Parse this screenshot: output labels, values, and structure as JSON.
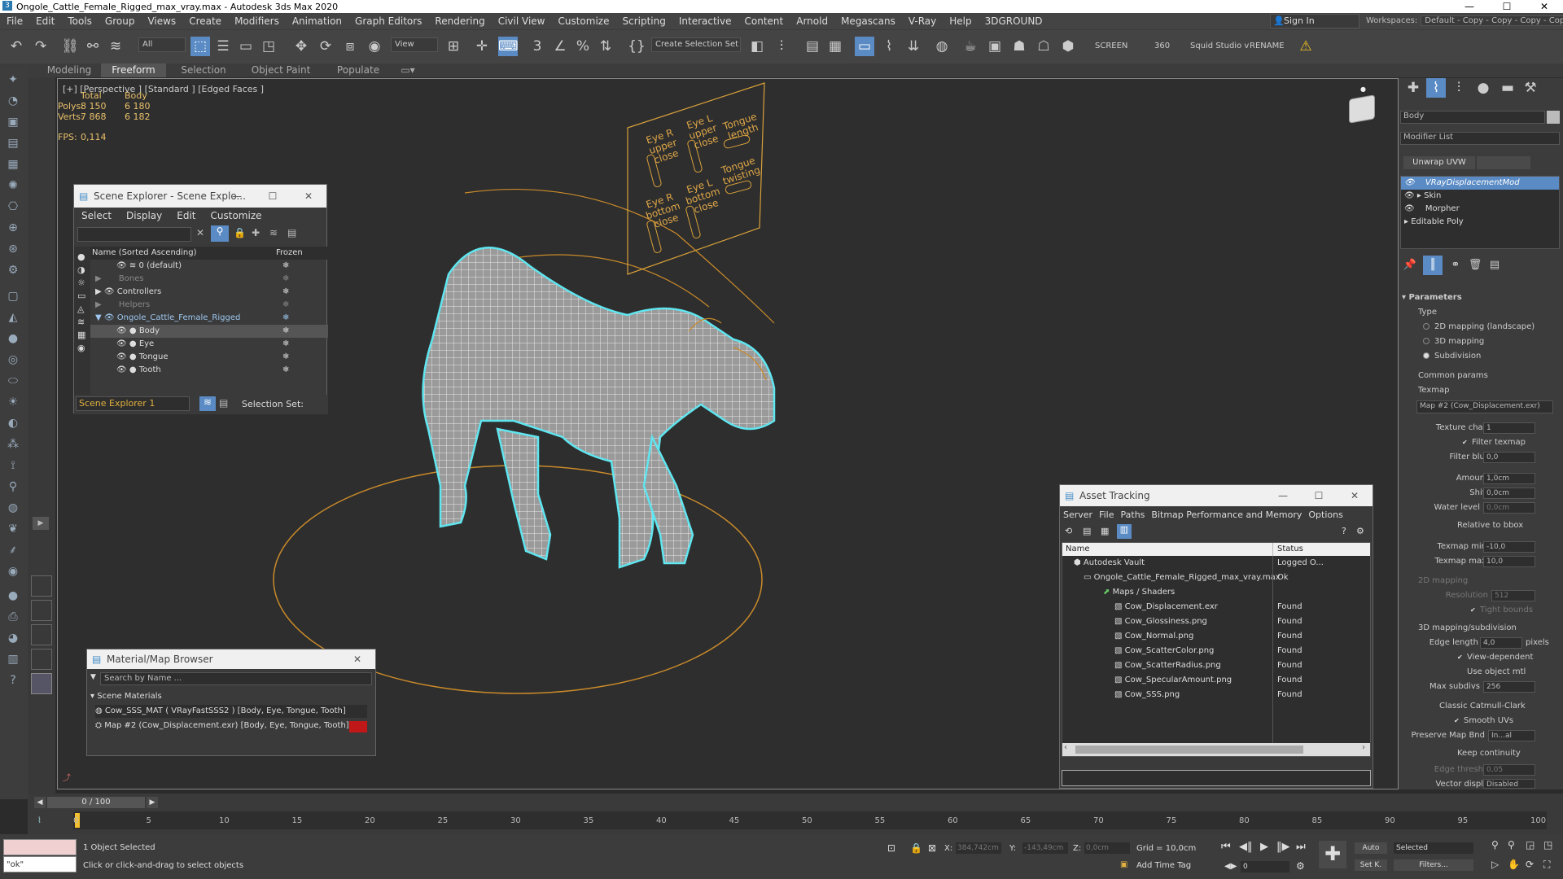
{
  "window": {
    "title": "Ongole_Cattle_Female_Rigged_max_vray.max - Autodesk 3ds Max 2020",
    "min": "—",
    "max": "☐",
    "close": "✕"
  },
  "menu": [
    "File",
    "Edit",
    "Tools",
    "Group",
    "Views",
    "Create",
    "Modifiers",
    "Animation",
    "Graph Editors",
    "Rendering",
    "Civil View",
    "Customize",
    "Scripting",
    "Interactive",
    "Content",
    "Arnold",
    "Megascans",
    "V-Ray",
    "Help",
    "3DGROUND"
  ],
  "signin": "Sign In",
  "workspaces": {
    "label": "Workspaces:",
    "value": "Default - Copy - Copy - Copy - Copy"
  },
  "toolbar": {
    "filter": "All",
    "view": "View",
    "selset": "Create Selection Set",
    "screen": "SCREEN",
    "n360": "360",
    "squid": "Squid Studio v",
    "rename": "RENAME"
  },
  "ribbon": [
    "Modeling",
    "Freeform",
    "Selection",
    "Object Paint",
    "Populate"
  ],
  "viewport": {
    "label": "[+] [Perspective ] [Standard ] [Edged Faces ]",
    "total": "Total",
    "body": "Body",
    "polys_label": "Polys:",
    "polys_total": "8 150",
    "polys_body": "6 180",
    "verts_label": "Verts:",
    "verts_total": "7 868",
    "verts_body": "6 182",
    "fps_label": "FPS:",
    "fps": "0,114"
  },
  "panel": {
    "labels": [
      "Eye R upper close",
      "Eye L upper close",
      "Tongue length",
      "Eye R bottom close",
      "Eye L bottom close",
      "Tongue twisting"
    ]
  },
  "scene_explorer": {
    "title": "Scene Explorer - Scene Explo...",
    "menu": [
      "Select",
      "Display",
      "Edit",
      "Customize"
    ],
    "col_name": "Name (Sorted Ascending)",
    "col_frozen": "Frozen",
    "rows": [
      "0 (default)",
      "Bones",
      "Controllers",
      "Helpers",
      "Ongole_Cattle_Female_Rigged",
      "Body",
      "Eye",
      "Tongue",
      "Tooth"
    ],
    "footer_name": "Scene Explorer 1",
    "footer_selset": "Selection Set:"
  },
  "material_browser": {
    "title": "Material/Map Browser",
    "search": "Search by Name ...",
    "section": "Scene Materials",
    "items": [
      "Cow_SSS_MAT  ( VRayFastSSS2 )  [Body, Eye, Tongue, Tooth]",
      "Map #2 (Cow_Displacement.exr)  [Body, Eye, Tongue, Tooth]"
    ]
  },
  "asset_tracking": {
    "title": "Asset Tracking",
    "menu": [
      "Server",
      "File",
      "Paths",
      "Bitmap Performance and Memory",
      "Options"
    ],
    "col_name": "Name",
    "col_status": "Status",
    "rows": [
      {
        "name": "Autodesk Vault",
        "status": "Logged O..."
      },
      {
        "name": "Ongole_Cattle_Female_Rigged_max_vray.max",
        "status": "Ok"
      },
      {
        "name": "Maps / Shaders",
        "status": ""
      },
      {
        "name": "Cow_Displacement.exr",
        "status": "Found"
      },
      {
        "name": "Cow_Glossiness.png",
        "status": "Found"
      },
      {
        "name": "Cow_Normal.png",
        "status": "Found"
      },
      {
        "name": "Cow_ScatterColor.png",
        "status": "Found"
      },
      {
        "name": "Cow_ScatterRadius.png",
        "status": "Found"
      },
      {
        "name": "Cow_SpecularAmount.png",
        "status": "Found"
      },
      {
        "name": "Cow_SSS.png",
        "status": "Found"
      }
    ]
  },
  "command_panel": {
    "object_name": "Body",
    "modifier_list": "Modifier List",
    "unwrap": "Unwrap UVW",
    "stack": [
      "VRayDisplacementMod",
      "Skin",
      "Morpher",
      "Editable Poly"
    ],
    "parameters": "Parameters",
    "type": "Type",
    "type_opts": [
      "2D mapping (landscape)",
      "3D mapping",
      "Subdivision"
    ],
    "common": "Common params",
    "texmap": "Texmap",
    "texmap_value": "Map #2 (Cow_Displacement.exr)",
    "texture_chan": "Texture chan",
    "texture_chan_v": "1",
    "filter_texmap": "Filter texmap",
    "filter_blur": "Filter blur",
    "filter_blur_v": "0,0",
    "amount": "Amount",
    "amount_v": "1,0cm",
    "shift": "Shift",
    "shift_v": "0,0cm",
    "water": "Water level",
    "water_v": "0,0cm",
    "rel_bbox": "Relative to bbox",
    "tex_min": "Texmap min",
    "tex_min_v": "-10,0",
    "tex_max": "Texmap max",
    "tex_max_v": "10,0",
    "map2d": "2D mapping",
    "resolution": "Resolution",
    "resolution_v": "512",
    "tight": "Tight bounds",
    "map3d": "3D mapping/subdivision",
    "edge_len": "Edge length",
    "edge_len_v": "4,0",
    "pixels": "pixels",
    "view_dep": "View-dependent",
    "use_obj": "Use object mtl",
    "max_subdivs": "Max subdivs",
    "max_subdivs_v": "256",
    "catmull": "Classic Catmull-Clark",
    "smooth_uv": "Smooth UVs",
    "preserve": "Preserve Map Bnd",
    "preserve_v": "In...al",
    "keep": "Keep continuity",
    "edge_thresh": "Edge thresh",
    "edge_thresh_v": "0,05",
    "vector": "Vector displ",
    "vector_v": "Disabled"
  },
  "timeline": {
    "frame": "0 / 100",
    "ticks": [
      "0",
      "5",
      "10",
      "15",
      "20",
      "25",
      "30",
      "35",
      "40",
      "45",
      "50",
      "55",
      "60",
      "65",
      "70",
      "75",
      "80",
      "85",
      "90",
      "95",
      "100"
    ]
  },
  "status": {
    "maxscript": "\"ok\"",
    "selected": "1 Object Selected",
    "prompt": "Click or click-and-drag to select objects",
    "x_label": "X:",
    "x": "384,742cm",
    "y_label": "Y:",
    "y": "-143,49cm",
    "z_label": "Z:",
    "z": "0,0cm",
    "grid": "Grid = 10,0cm",
    "add_tag": "Add Time Tag",
    "auto": "Auto",
    "selected_mode": "Selected",
    "setk": "Set K.",
    "filters": "Filters...",
    "frame_field": "0"
  }
}
